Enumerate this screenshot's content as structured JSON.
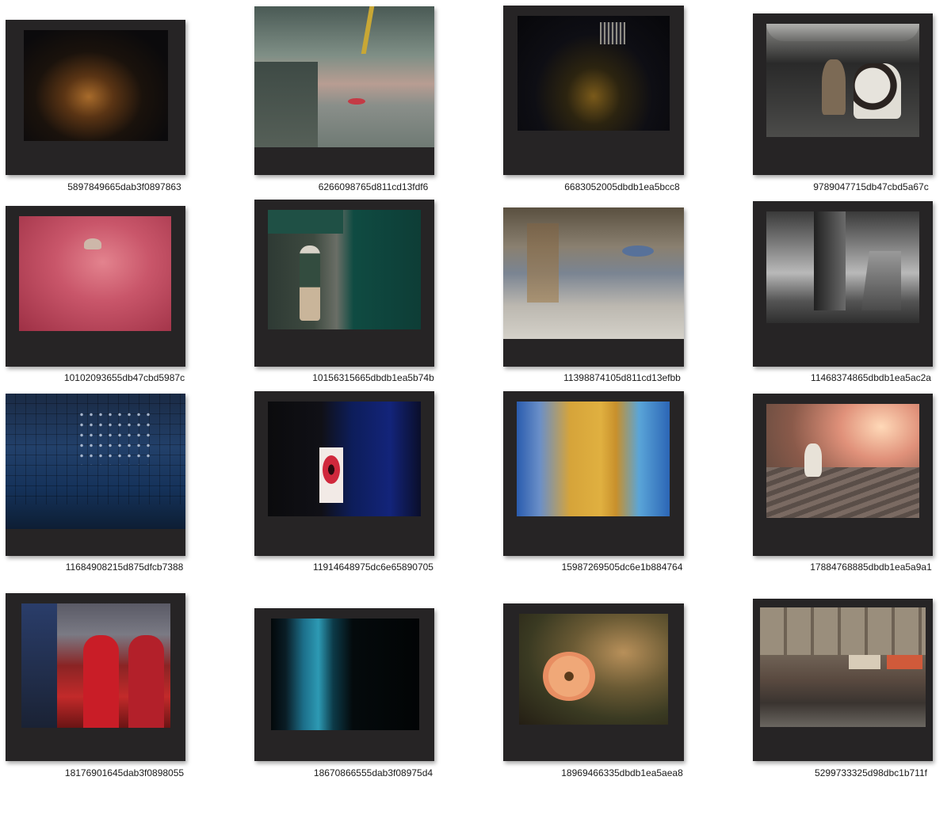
{
  "files": [
    {
      "name": "5897849665dab3f0897863"
    },
    {
      "name": "6266098765d811cd13fdf6"
    },
    {
      "name": "6683052005dbdb1ea5bcc8"
    },
    {
      "name": "9789047715db47cbd5a67c"
    },
    {
      "name": "10102093655db47cbd5987c"
    },
    {
      "name": "10156315665dbdb1ea5b74b"
    },
    {
      "name": "11398874105d811cd13efbb"
    },
    {
      "name": "11468374865dbdb1ea5ac2a"
    },
    {
      "name": "11684908215d875dfcb7388"
    },
    {
      "name": "11914648975dc6e65890705"
    },
    {
      "name": "15987269505dc6e1b884764"
    },
    {
      "name": "17884768885dbdb1ea5a9a1"
    },
    {
      "name": "18176901645dab3f0898055"
    },
    {
      "name": "18670866555dab3f08975d4"
    },
    {
      "name": "18969466335dbdb1ea5aea8"
    },
    {
      "name": "5299733325d98dbc1b711f"
    }
  ],
  "colors": {
    "frame": "#262425",
    "credit_accent": "#d4243a"
  }
}
